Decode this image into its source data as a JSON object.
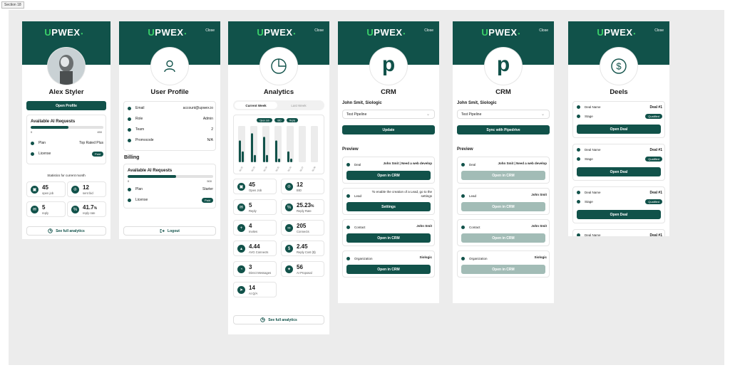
{
  "section_label": "Section 18",
  "brand": {
    "u": "U",
    "rest": "PWEX",
    "dot": "•"
  },
  "close_label": "Close",
  "profile": {
    "name": "Alex Styler",
    "open_profile": "Open Profile",
    "ai_title": "Available AI Requests",
    "ai_min": "0",
    "ai_max": "450",
    "ai_fill": 0.52,
    "plan_label": "Plan",
    "plan_value": "Top Rated Plus",
    "license_label": "License",
    "license_value": "Paid",
    "stats_title": "Statistics for current month",
    "stats": [
      {
        "num": "45",
        "label": "open job",
        "icon": "briefcase-icon"
      },
      {
        "num": "12",
        "label": "sent bid",
        "icon": "trophy-icon"
      },
      {
        "num": "5",
        "label": "reply",
        "icon": "mail-icon"
      },
      {
        "num": "41.7",
        "unit": "%",
        "label": "reply rate",
        "icon": "percent-icon"
      }
    ],
    "see_full": "See full analytics"
  },
  "user_profile": {
    "title": "User Profile",
    "rows": [
      {
        "label": "Email",
        "value": "account@upwex.io"
      },
      {
        "label": "Role",
        "value": "Admin"
      },
      {
        "label": "Team",
        "value": "2"
      },
      {
        "label": "Promocode",
        "value": "N/A"
      }
    ],
    "billing": "Billing",
    "ai_title": "Available AI Requests",
    "ai_min": "0",
    "ai_max": "500",
    "ai_fill": 0.57,
    "plan_label": "Plan",
    "plan_value": "Starter",
    "license_label": "License",
    "license_value": "Paid",
    "logout": "Logout"
  },
  "analytics": {
    "title": "Analytics",
    "tab_current": "Current Week",
    "tab_last": "Last Week",
    "legend": [
      "Open Job",
      "BID",
      "Reply"
    ],
    "chart_data": {
      "type": "bar",
      "categories": [
        "06.22",
        "06.23",
        "06.24",
        "06.25",
        "06.26",
        "06.27",
        "06.28"
      ],
      "series": [
        {
          "name": "Open Job",
          "values": [
            10,
            10,
            10,
            10,
            10,
            10,
            10
          ]
        },
        {
          "name": "BID",
          "values": [
            6,
            8,
            7,
            6,
            3,
            0,
            0
          ]
        },
        {
          "name": "Reply",
          "values": [
            3,
            2,
            2,
            1,
            1,
            0,
            0
          ]
        }
      ]
    },
    "stats": [
      {
        "num": "45",
        "label": "Open Job",
        "icon": "briefcase-icon"
      },
      {
        "num": "12",
        "label": "BID",
        "icon": "trophy-icon"
      },
      {
        "num": "5",
        "label": "Reply",
        "icon": "mail-icon"
      },
      {
        "num": "25.23",
        "unit": "%",
        "label": "Reply Rate",
        "icon": "percent-icon"
      },
      {
        "num": "4",
        "label": "Invites",
        "icon": "user-plus-icon"
      },
      {
        "num": "205",
        "label": "Connects",
        "icon": "link-icon"
      },
      {
        "num": "4.44",
        "label": "AVG Connects",
        "icon": "chart-icon"
      },
      {
        "num": "2.45",
        "label": "Reply Cost ($)",
        "icon": "dollar-icon"
      },
      {
        "num": "3",
        "label": "Direct Messages",
        "icon": "chat-icon"
      },
      {
        "num": "56",
        "label": "AI Proposal",
        "icon": "ai-icon"
      },
      {
        "num": "14",
        "label": "AI Q/A",
        "icon": "send-icon"
      }
    ],
    "see_full": "See full analytics"
  },
  "crm1": {
    "title": "CRM",
    "contact": "John Smit, Siologic",
    "pipeline": "Test Pipeline",
    "action": "Update",
    "preview": "Preview",
    "items": [
      {
        "label": "Deal",
        "value": "John Smit | Need a web develop",
        "button": "Open in CRM"
      },
      {
        "label": "Lead",
        "value": "To enable the creation of a Lead, go to the settings",
        "button": "Settings"
      },
      {
        "label": "Contact",
        "value": "John Smit",
        "button": "Open in CRM"
      },
      {
        "label": "Organization",
        "value": "Siologic",
        "button": "Open in CRM"
      }
    ]
  },
  "crm2": {
    "title": "CRM",
    "contact": "John Smit, Siologic",
    "pipeline": "Test Pipeline",
    "action": "Sync with Pipedrive",
    "preview": "Preview",
    "items": [
      {
        "label": "Deal",
        "value": "John Smit | Need a web develop",
        "button": "Open in CRM"
      },
      {
        "label": "Lead",
        "value": "John Smit",
        "button": "Open in CRM"
      },
      {
        "label": "Contact",
        "value": "John Smit",
        "button": "Open in CRM"
      },
      {
        "label": "Organization",
        "value": "Siologic",
        "button": "Open in CRM"
      }
    ]
  },
  "deals": {
    "title": "Deels",
    "items": [
      {
        "name_label": "Deal Name",
        "name": "Deal #1",
        "stage_label": "Stage",
        "stage": "Qualified",
        "button": "Open Deal"
      },
      {
        "name_label": "Deal Name",
        "name": "Deal #1",
        "stage_label": "Stage",
        "stage": "Qualified",
        "button": "Open Deal"
      },
      {
        "name_label": "Deal Name",
        "name": "Deal #1",
        "stage_label": "Stage",
        "stage": "Qualified",
        "button": "Open Deal"
      },
      {
        "name_label": "Deal Name",
        "name": "Deal #1"
      }
    ]
  },
  "colors": {
    "brand": "#11524a",
    "accent": "#3bd06a",
    "disabled": "#a2bcb6",
    "canvas": "#ececec"
  }
}
